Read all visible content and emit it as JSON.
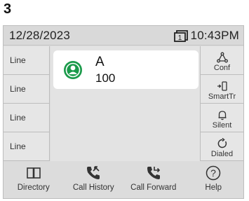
{
  "step_number": "3",
  "status_bar": {
    "date": "12/28/2023",
    "time": "10:43PM",
    "line_indicator": "1"
  },
  "line_keys": [
    {
      "label": "Line"
    },
    {
      "label": "Line"
    },
    {
      "label": "Line"
    },
    {
      "label": "Line"
    }
  ],
  "active_call": {
    "name": "A",
    "number": "100",
    "avatar_icon": "person-icon",
    "status_color": "#1a9a4a"
  },
  "soft_keys": [
    {
      "label": "Conf",
      "icon": "conference-icon"
    },
    {
      "label": "SmartTr",
      "icon": "smart-transfer-icon"
    },
    {
      "label": "Silent",
      "icon": "bell-icon"
    },
    {
      "label": "Dialed",
      "icon": "redial-icon"
    }
  ],
  "bottom_nav": [
    {
      "label": "Directory",
      "icon": "book-icon"
    },
    {
      "label": "Call History",
      "icon": "call-history-icon"
    },
    {
      "label": "Call Forward",
      "icon": "call-forward-icon"
    },
    {
      "label": "Help",
      "icon": "help-icon"
    }
  ]
}
